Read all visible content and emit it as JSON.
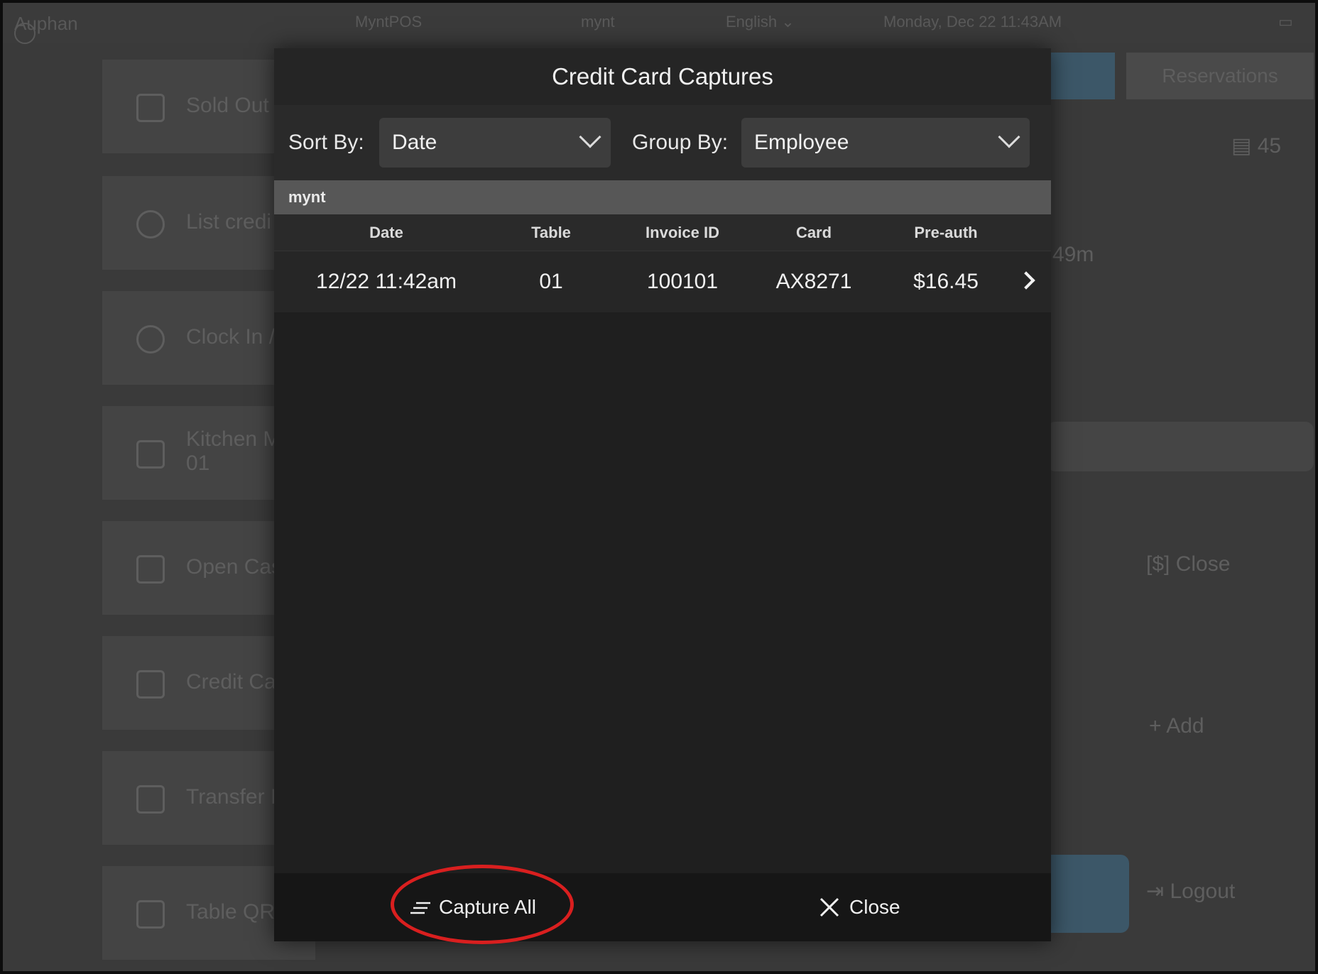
{
  "topbar": {
    "brand": "Auphan",
    "store": "MyntPOS",
    "user": "mynt",
    "language": "English",
    "datetime": "Monday, Dec 22 11:43AM"
  },
  "sidebar": {
    "items": [
      {
        "label": "Sold Out",
        "icon": "sold-out-icon"
      },
      {
        "label": "List credi",
        "icon": "dollar-refresh-icon"
      },
      {
        "label": "Clock In /",
        "icon": "stopwatch-icon"
      },
      {
        "label": "Kitchen M",
        "sub": "01",
        "icon": "kitchen-note-icon"
      },
      {
        "label": "Open Cas",
        "icon": "cash-drawer-icon"
      },
      {
        "label": "Credit Ca",
        "icon": "credit-card-icon"
      },
      {
        "label": "Transfer I",
        "icon": "transfer-doc-icon"
      },
      {
        "label": "Table QR",
        "icon": "qr-icon"
      }
    ]
  },
  "right_panel": {
    "reservations_label": "Reservations",
    "count": "45",
    "timer": "49m",
    "close_label": "Close",
    "add_label": "Add",
    "logout_label": "Logout"
  },
  "modal": {
    "title": "Credit Card Captures",
    "sort_by_label": "Sort By:",
    "sort_by_value": "Date",
    "group_by_label": "Group By:",
    "group_by_value": "Employee",
    "group_header": "mynt",
    "columns": [
      "Date",
      "Table",
      "Invoice ID",
      "Card",
      "Pre-auth"
    ],
    "rows": [
      {
        "date": "12/22 11:42am",
        "table": "01",
        "invoice_id": "100101",
        "card": "AX8271",
        "preauth": "$16.45"
      }
    ],
    "capture_all_label": "Capture All",
    "close_label": "Close"
  },
  "colors": {
    "link": "#45a6d8",
    "annotation": "#d91f1f"
  }
}
